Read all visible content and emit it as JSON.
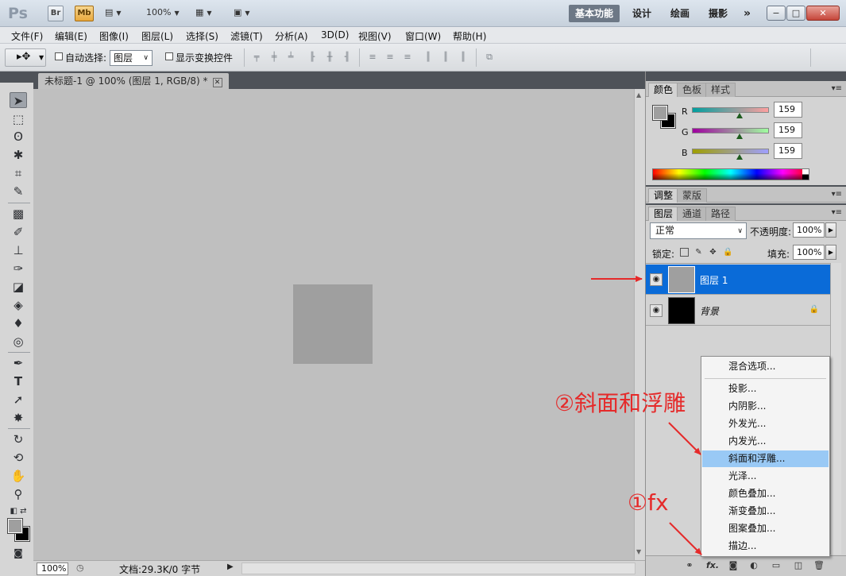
{
  "titlebar": {
    "logo": "Ps",
    "bridge_label": "Br",
    "mini_bridge_label": "Mb",
    "zoom": "100%",
    "workspaces": [
      "基本功能",
      "设计",
      "绘画",
      "摄影"
    ],
    "more": "»"
  },
  "menubar": {
    "items": [
      "文件(F)",
      "编辑(E)",
      "图像(I)",
      "图层(L)",
      "选择(S)",
      "滤镜(T)",
      "分析(A)",
      "3D(D)",
      "视图(V)",
      "窗口(W)",
      "帮助(H)"
    ]
  },
  "options": {
    "auto_select_label": "自动选择:",
    "auto_select_value": "图层",
    "show_transform_label": "显示变换控件"
  },
  "document": {
    "tab_title": "未标题-1 @ 100% (图层 1, RGB/8) *",
    "zoom": "100%",
    "doc_info": "文档:29.3K/0 字节"
  },
  "color_panel": {
    "tabs": [
      "颜色",
      "色板",
      "样式"
    ],
    "foreground": "#9f9f9f",
    "background": "#000000",
    "channels": [
      {
        "label": "R",
        "value": "159"
      },
      {
        "label": "G",
        "value": "159"
      },
      {
        "label": "B",
        "value": "159"
      }
    ]
  },
  "adjust_panel": {
    "tabs": [
      "调整",
      "蒙版"
    ]
  },
  "layers_panel": {
    "tabs": [
      "图层",
      "通道",
      "路径"
    ],
    "blend_mode": "正常",
    "opacity_label": "不透明度:",
    "opacity": "100%",
    "lock_label": "锁定:",
    "fill_label": "填充:",
    "fill": "100%",
    "layers": [
      {
        "name": "图层 1",
        "selected": true
      },
      {
        "name": "背景",
        "selected": false,
        "locked": true
      }
    ]
  },
  "fx_menu": {
    "items": [
      "混合选项...",
      "投影...",
      "内阴影...",
      "外发光...",
      "内发光...",
      "斜面和浮雕...",
      "光泽...",
      "颜色叠加...",
      "渐变叠加...",
      "图案叠加...",
      "描边..."
    ],
    "highlighted": "斜面和浮雕..."
  },
  "annotations": {
    "step1": "①fx",
    "step2": "②斜面和浮雕",
    "color": "#e52a2a"
  }
}
